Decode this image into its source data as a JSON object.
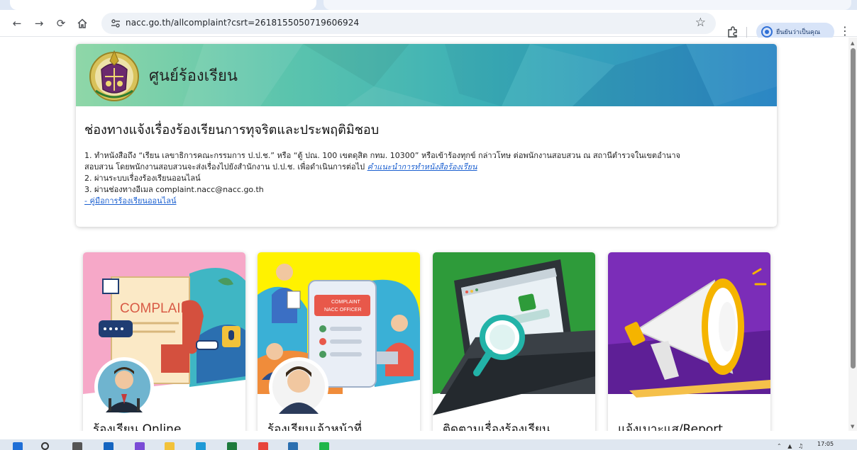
{
  "browser": {
    "url": "nacc.go.th/allcomplaint?csrt=2618155050719606924",
    "profile_label": "ยืนยันว่าเป็นคุณ"
  },
  "page": {
    "banner_title": "ศูนย์ร้องเรียน",
    "heading": "ช่องทางแจ้งเรื่องร้องเรียนการทุจริตและประพฤติมิชอบ",
    "item1_line1": "1. ทำหนังสือถึง “เรียน เลขาธิการคณะกรรมการ ป.ป.ช.” หรือ “ตู้ ปณ. 100 เขตดุสิต กทม. 10300” หรือเข้าร้องทุกข์ กล่าวโทษ ต่อพนักงานสอบสวน ณ สถานีตำรวจในเขตอำนาจ",
    "item1_line2": "สอบสวน โดยพนักงานสอบสวนจะส่งเรื่องไปยังสำนักงาน ป.ป.ช. เพื่อดำเนินการต่อไป ",
    "item1_link": "คำแนะนำการทำหนังสือร้องเรียน",
    "item2": "2. ผ่านระบบเรื่องร้องเรียนออนไลน์",
    "item3": "3. ผ่านช่องทางอีเมล complaint.nacc@nacc.go.th",
    "manual_link": "- คู่มือการร้องเรียนออนไลน์"
  },
  "tiles": [
    {
      "label": "ร้องเรียน Online",
      "art_text": "COMPLAINT"
    },
    {
      "label": "ร้องเรียนเจ้าหน้าที่",
      "art_text_1": "COMPLAINT",
      "art_text_2": "NACC OFFICER"
    },
    {
      "label": "ติดตามเรื่องร้องเรียน"
    },
    {
      "label": "แจ้งเบาะแส/Report"
    }
  ],
  "taskbar": {
    "time": "17:05"
  },
  "colors": {
    "banner_start": "#8fd7a8",
    "banner_end": "#2b86c4",
    "tile1_bg": "#f6a8c8",
    "tile2_bg": "#fff200",
    "tile3_bg": "#2e9b3a",
    "tile4_bg": "#7b2db8",
    "link": "#1a5fd0"
  }
}
